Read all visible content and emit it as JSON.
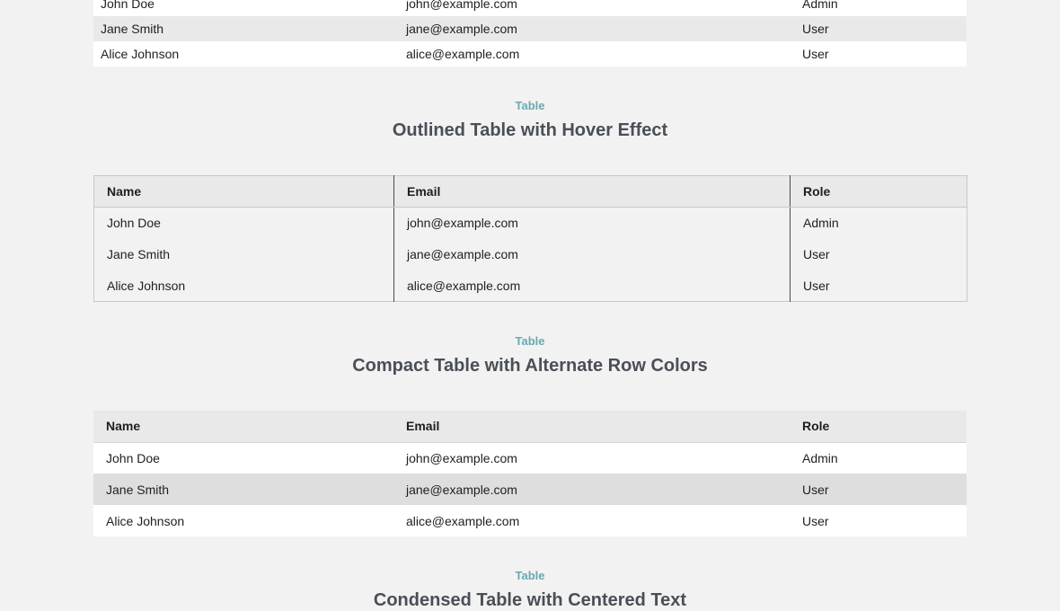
{
  "top_table": {
    "rows": [
      {
        "name": "John Doe",
        "email": "john@example.com",
        "role": "Admin"
      },
      {
        "name": "Jane Smith",
        "email": "jane@example.com",
        "role": "User"
      },
      {
        "name": "Alice Johnson",
        "email": "alice@example.com",
        "role": "User"
      }
    ]
  },
  "outlined": {
    "eyebrow": "Table",
    "title": "Outlined Table with Hover Effect",
    "headers": [
      "Name",
      "Email",
      "Role"
    ],
    "rows": [
      {
        "name": "John Doe",
        "email": "john@example.com",
        "role": "Admin"
      },
      {
        "name": "Jane Smith",
        "email": "jane@example.com",
        "role": "User"
      },
      {
        "name": "Alice Johnson",
        "email": "alice@example.com",
        "role": "User"
      }
    ]
  },
  "compact": {
    "eyebrow": "Table",
    "title": "Compact Table with Alternate Row Colors",
    "headers": [
      "Name",
      "Email",
      "Role"
    ],
    "rows": [
      {
        "name": "John Doe",
        "email": "john@example.com",
        "role": "Admin"
      },
      {
        "name": "Jane Smith",
        "email": "jane@example.com",
        "role": "User"
      },
      {
        "name": "Alice Johnson",
        "email": "alice@example.com",
        "role": "User"
      }
    ]
  },
  "condensed": {
    "eyebrow": "Table",
    "title": "Condensed Table with Centered Text"
  },
  "colors": {
    "accent": "#6aa9ae",
    "heading": "#4a4f57",
    "background": "#f2f2f2"
  }
}
